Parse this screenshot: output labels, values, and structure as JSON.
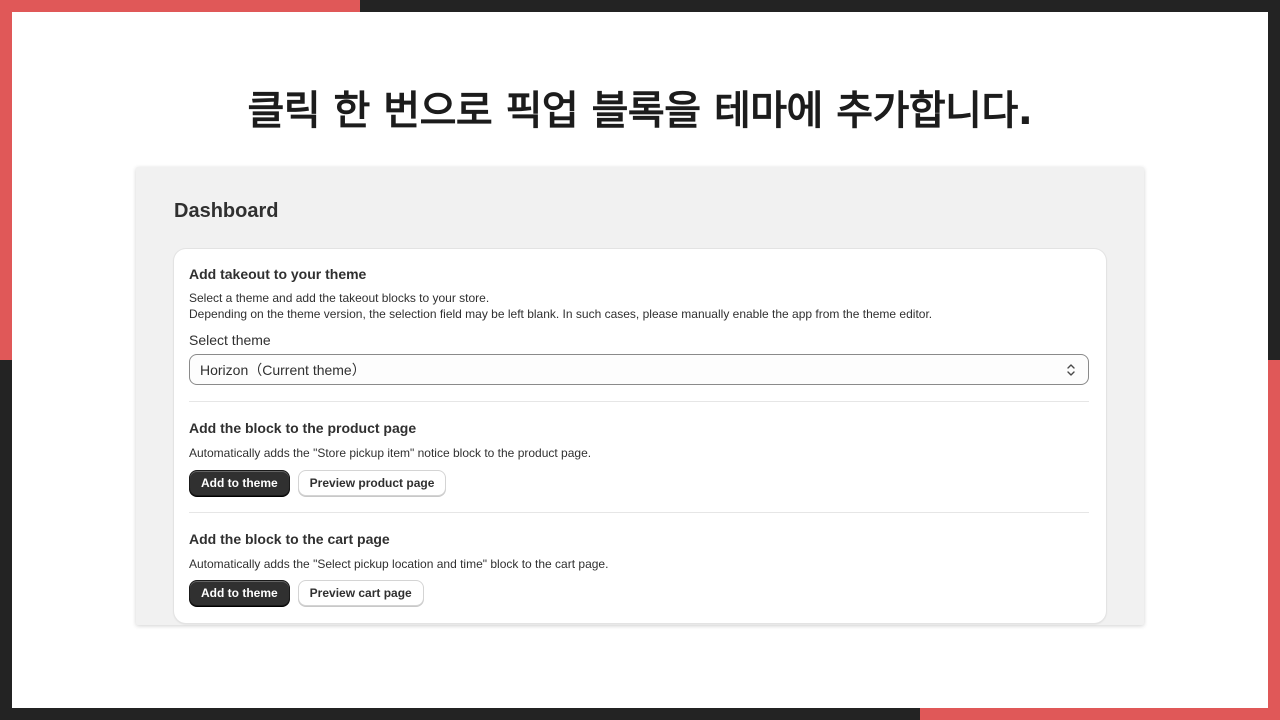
{
  "headline": "클릭 한 번으로 픽업 블록을 테마에 추가합니다.",
  "colors": {
    "accent": "#e05858",
    "frame": "#232323",
    "primary_button": "#303030"
  },
  "dashboard": {
    "title": "Dashboard",
    "theme_section": {
      "title": "Add takeout to your theme",
      "description_line1": "Select a theme and add the takeout blocks to your store.",
      "description_line2": "Depending on the theme version, the selection field may be left blank. In such cases, please manually enable the app from the theme editor.",
      "select_label": "Select theme",
      "select_value": "Horizon（Current theme）",
      "select_icon": "chevron-up-down-icon"
    },
    "product_section": {
      "title": "Add the block to the product page",
      "description": "Automatically adds the \"Store pickup item\" notice block to the product page.",
      "add_button": "Add to theme",
      "preview_button": "Preview product page"
    },
    "cart_section": {
      "title": "Add the block to the cart page",
      "description": "Automatically adds the \"Select pickup location and time\" block to the cart page.",
      "add_button": "Add to theme",
      "preview_button": "Preview cart page"
    }
  }
}
